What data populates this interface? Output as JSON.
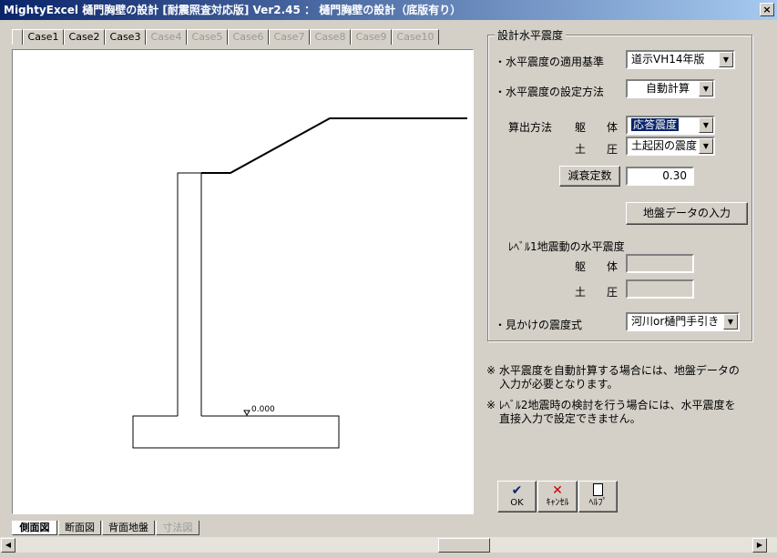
{
  "window": {
    "title": "MightyExcel 樋門胸壁の設計 [耐震照査対応版] Ver2.45 ： 樋門胸壁の設計（底版有り）",
    "close_glyph": "×"
  },
  "case_tabs": [
    "Case1",
    "Case2",
    "Case3",
    "Case4",
    "Case5",
    "Case6",
    "Case7",
    "Case8",
    "Case9",
    "Case10"
  ],
  "view_tabs": [
    "側面図",
    "断面図",
    "背面地盤",
    "寸法図"
  ],
  "drawing": {
    "elevation_label": "0.000"
  },
  "seismic": {
    "group_title": "設計水平震度",
    "standard_label": "・水平震度の適用基準",
    "standard_value": "道示ⅤH14年版",
    "method_label": "・水平震度の設定方法",
    "method_value": "自動計算",
    "calc_label": "算出方法",
    "body_label_1": "躯",
    "body_label_2": "体",
    "body_value": "応答震度",
    "soil_label_1": "土",
    "soil_label_2": "圧",
    "soil_value": "土起因の震度",
    "damping_button": "減衰定数",
    "damping_value": "0.30",
    "ground_data_button": "地盤データの入力",
    "level1_title": "ﾚﾍﾞﾙ1地震動の水平震度",
    "apparent_label": "・見かけの震度式",
    "apparent_value": "河川or樋門手引き"
  },
  "notes": {
    "note1_line1": "※ 水平震度を自動計算する場合には、地盤データの",
    "note1_line2": "入力が必要となります。",
    "note2_line1": "※ ﾚﾍﾞﾙ2地震時の検討を行う場合には、水平震度を",
    "note2_line2": "直接入力で設定できません。"
  },
  "buttons": {
    "ok": "OK",
    "cancel": "ｷｬﾝｾﾙ",
    "help": "ﾍﾙﾌﾟ"
  },
  "colors": {
    "ok_icon": "#0a246a",
    "cancel_icon": "#c00000"
  }
}
